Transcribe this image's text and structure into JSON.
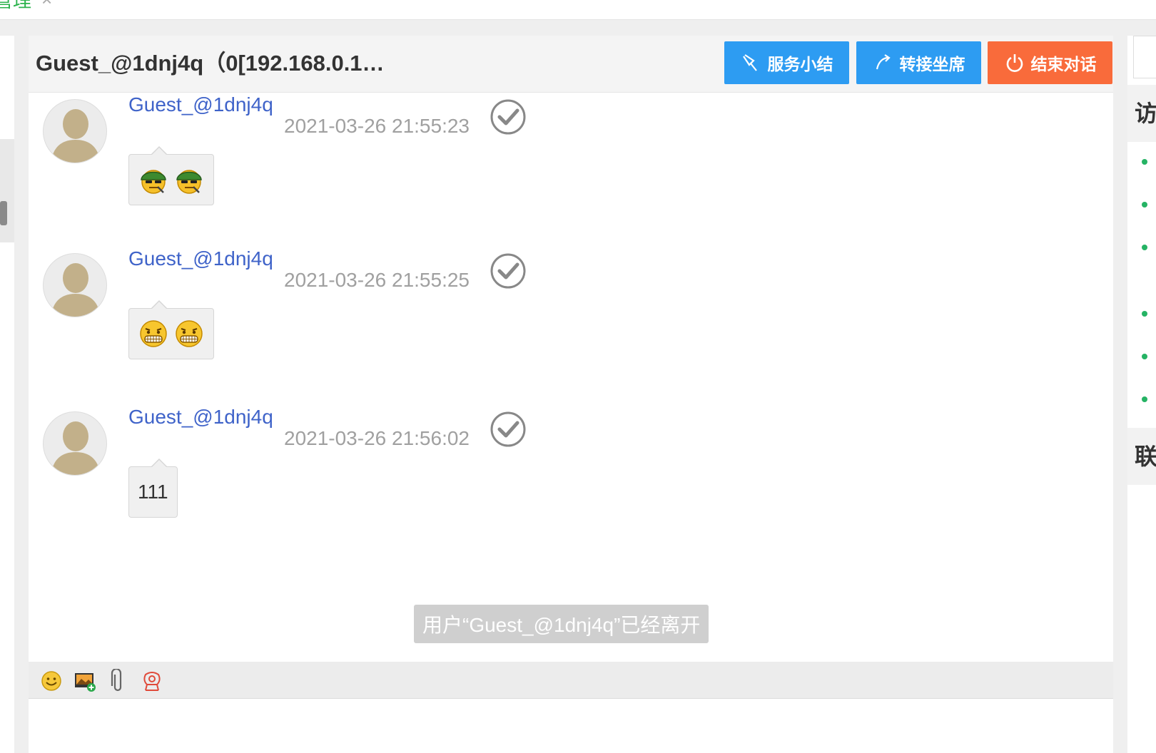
{
  "top_tab": {
    "label": "管理",
    "close": "×"
  },
  "header": {
    "title": "Guest_@1dnj4q（0[192.168.0.1…",
    "buttons": {
      "summary": "服务小结",
      "transfer": "转接坐席",
      "end": "结束对话"
    }
  },
  "messages": [
    {
      "sender": "Guest_@1dnj4q",
      "time": "2021-03-26 21:55:23",
      "type": "emoji",
      "emojis": [
        "army-helmet-smirk-emoji",
        "army-helmet-smirk-emoji"
      ]
    },
    {
      "sender": "Guest_@1dnj4q",
      "time": "2021-03-26 21:55:25",
      "type": "emoji",
      "emojis": [
        "grimace-emoji",
        "grimace-emoji"
      ]
    },
    {
      "sender": "Guest_@1dnj4q",
      "time": "2021-03-26 21:56:02",
      "type": "text",
      "text": "111"
    }
  ],
  "system_note": "用户“Guest_@1dnj4q”已经离开",
  "toolbar": {
    "items": [
      "smiley-icon",
      "image-upload-icon",
      "attachment-icon",
      "rating-flower-icon"
    ]
  },
  "input": {
    "value": "",
    "placeholder": ""
  },
  "right_panel": {
    "section1_label": "访",
    "section2_label": "联"
  },
  "colors": {
    "primary_button": "#2d9cf2",
    "end_button": "#f96b3b",
    "sender_name": "#3f63c9",
    "status_dot": "#25b364"
  }
}
